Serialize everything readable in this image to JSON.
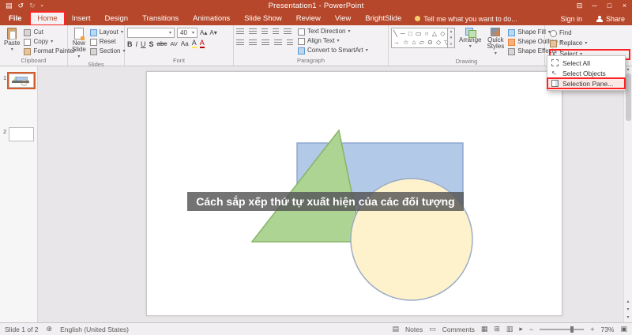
{
  "colors": {
    "accent": "#B7472A",
    "annotation": "#FF2222",
    "triangle_fill": "#AED494",
    "rectangle_fill": "#B3C9E8",
    "circle_fill": "#FDF2CC"
  },
  "titlebar": {
    "title": "Presentation1 - PowerPoint"
  },
  "tabrow": {
    "file": "File",
    "tabs": [
      "Home",
      "Insert",
      "Design",
      "Transitions",
      "Animations",
      "Slide Show",
      "Review",
      "View",
      "BrightSlide"
    ],
    "tell_me": "Tell me what you want to do...",
    "sign_in": "Sign in",
    "share": "Share"
  },
  "clipboard": {
    "label": "Clipboard",
    "paste": "Paste",
    "cut": "Cut",
    "copy": "Copy",
    "format_painter": "Format Painter"
  },
  "slides_group": {
    "label": "Slides",
    "new_slide": "New Slide",
    "layout": "Layout",
    "reset": "Reset",
    "section": "Section"
  },
  "font_group": {
    "label": "Font",
    "font_name": "",
    "font_size": "40",
    "bold": "B",
    "italic": "I",
    "underline": "U",
    "shadow": "S",
    "strike": "abc",
    "spacing": "AV",
    "case_btn": "Aa",
    "highlight": "A",
    "font_color": "A",
    "grow": "A▴",
    "shrink": "A▾"
  },
  "paragraph_group": {
    "label": "Paragraph",
    "text_direction": "Text Direction",
    "align_text": "Align Text",
    "smartart": "Convert to SmartArt"
  },
  "drawing_group": {
    "label": "Drawing",
    "arrange": "Arrange",
    "quick_styles": "Quick Styles",
    "shape_fill": "Shape Fill",
    "shape_outline": "Shape Outline",
    "shape_effects": "Shape Effects",
    "shapes_row1": "╲ ─ □ ▭ ○ △ ◇",
    "shapes_row2": "→ ☆ ⌂ ▱ ⊙ ◇ ▽"
  },
  "editing_group": {
    "find": "Find",
    "replace": "Replace",
    "select": "Select"
  },
  "select_menu": {
    "items": [
      {
        "label": "Select All"
      },
      {
        "label": "Select Objects"
      },
      {
        "label": "Selection Pane..."
      }
    ]
  },
  "thumbnails": {
    "slide1": "1",
    "slide2": "2"
  },
  "slide": {
    "caption": "Cách sắp xếp thứ tự xuất hiện của các đối tượng"
  },
  "statusbar": {
    "slide_info": "Slide 1 of 2",
    "language": "English (United States)",
    "notes": "Notes",
    "comments": "Comments",
    "zoom": "73%"
  }
}
